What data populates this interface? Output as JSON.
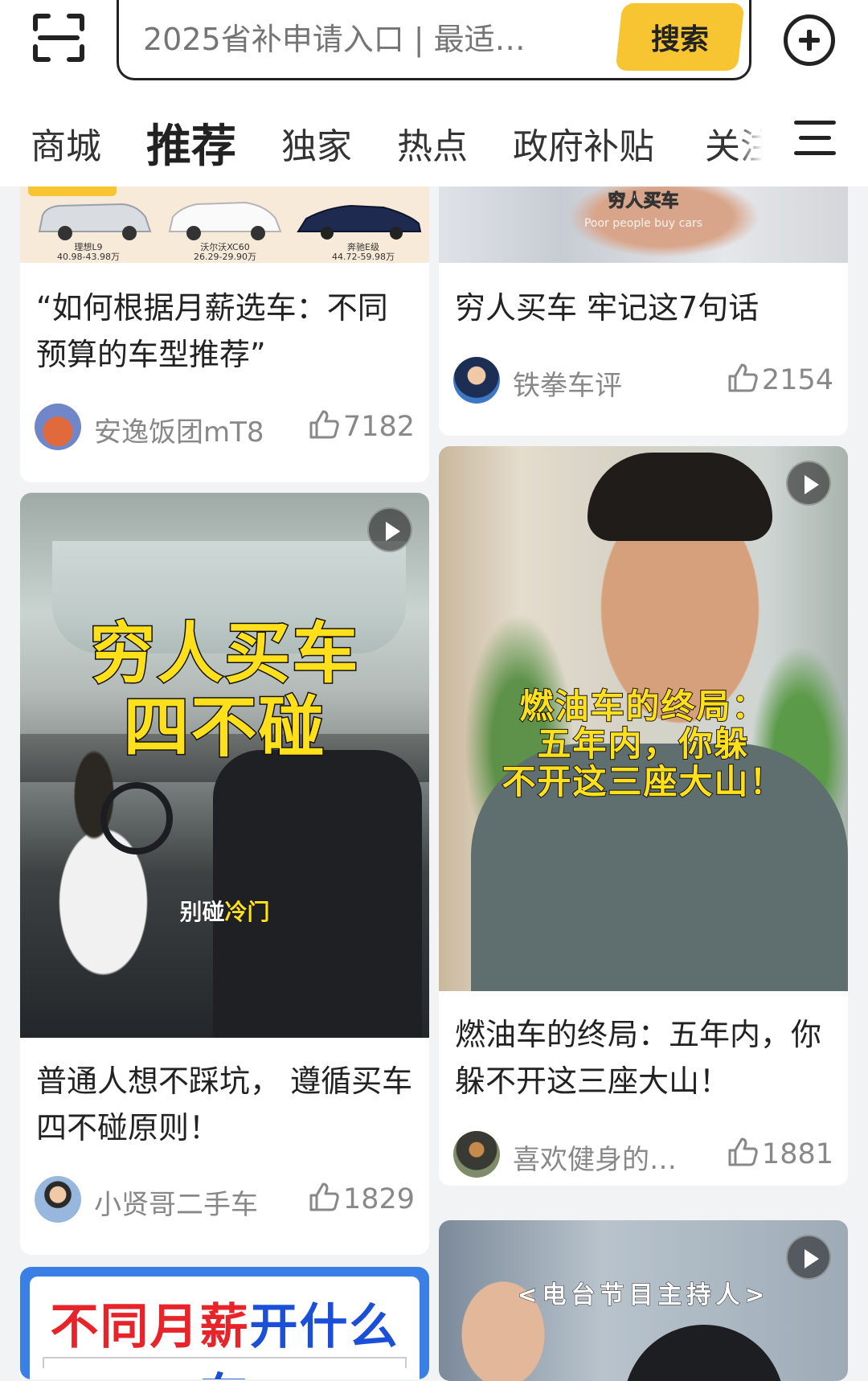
{
  "search": {
    "placeholder": "2025省补申请入口 | 最适…",
    "button_label": "搜索"
  },
  "tabs": [
    {
      "label": "商城"
    },
    {
      "label": "推荐"
    },
    {
      "label": "独家"
    },
    {
      "label": "热点"
    },
    {
      "label": "政府补贴"
    },
    {
      "label": "关注"
    }
  ],
  "colors": {
    "accent": "#f7c531",
    "background": "#f2f3f5"
  },
  "cards": {
    "card1": {
      "thumb_cars": [
        {
          "name": "理想L9",
          "price": "40.98-43.98万"
        },
        {
          "name": "沃尔沃XC60",
          "price": "26.29-29.90万"
        },
        {
          "name": "奔驰E级",
          "price": "44.72-59.98万"
        }
      ],
      "title": "“如何根据月薪选车：不同预算的车型推荐”",
      "author": "安逸饭团mT8",
      "likes": "7182"
    },
    "card2": {
      "thumb_overlay": "穷人买车",
      "thumb_caption": "Poor people buy cars",
      "title": "穷人买车 牢记这7句话",
      "author": "铁拳车评",
      "likes": "2154"
    },
    "card3": {
      "overlay_line1": "穷人买车",
      "overlay_line2": "四不碰",
      "subtitle_white": "别碰",
      "subtitle_yellow": "冷门",
      "title": "普通人想不踩坑， 遵循买车四不碰原则！",
      "author": "小贤哥二手车",
      "likes": "1829"
    },
    "card4": {
      "overlay_line1": "燃油车的终局：",
      "overlay_line2": "五年内，你躲",
      "overlay_line3": "不开这三座大山！",
      "title": "燃油车的终局：五年内，你躲不开这三座大山！",
      "author": "喜欢健身的…",
      "likes": "1881"
    },
    "card5": {
      "banner_red": "不同月薪",
      "banner_blue": "开什么车"
    },
    "card6": {
      "overlay": "<电台节目主持人>"
    }
  }
}
